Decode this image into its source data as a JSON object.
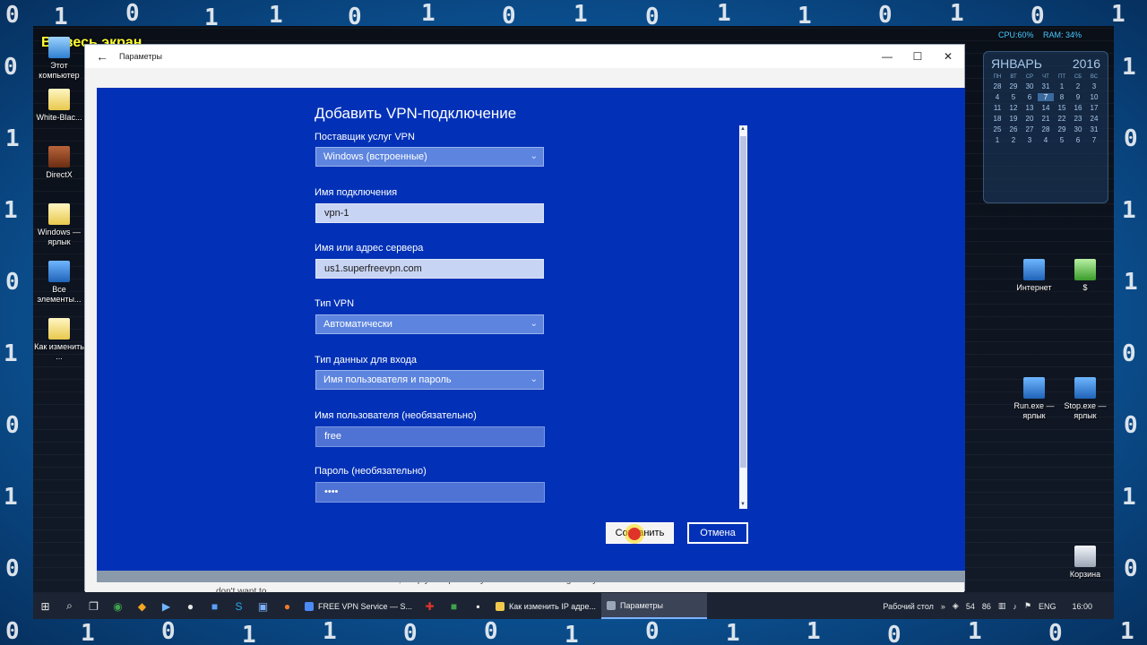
{
  "overlay": {
    "fullscreen_label": "Во весь экран"
  },
  "desktop": {
    "binary_digits": [
      "0",
      "1",
      "0",
      "1",
      "1",
      "0",
      "1",
      "0",
      "1",
      "0",
      "1",
      "1",
      "0",
      "1",
      "0",
      "1",
      "0",
      "1",
      "0",
      "1",
      "1",
      "0"
    ],
    "left_icons": [
      {
        "label": "Этот компьютер",
        "icon": "computer-icon"
      },
      {
        "label": "White-Blac...",
        "icon": "document-icon"
      },
      {
        "label": "DirectX",
        "icon": "archive-icon"
      },
      {
        "label": "Windows — ярлык",
        "icon": "shortcut-icon"
      },
      {
        "label": "Все элементы...",
        "icon": "control-panel-icon"
      },
      {
        "label": "Как изменить ...",
        "icon": "shortcut-icon"
      }
    ],
    "right_icons": [
      {
        "label": "Интернет",
        "icon": "network-icon"
      },
      {
        "label": "$",
        "icon": "notepad-icon"
      },
      {
        "label": "Run.exe — ярлык",
        "icon": "shortcut-icon"
      },
      {
        "label": "Stop.exe — ярлык",
        "icon": "shortcut-icon"
      },
      {
        "label": "Корзина",
        "icon": "recycle-bin-icon"
      }
    ]
  },
  "sysmon": {
    "cpu": "CPU:60%",
    "ram": "RAM: 34%"
  },
  "calendar": {
    "month": "ЯНВАРЬ",
    "year": "2016",
    "dows": [
      "ПН",
      "ВТ",
      "СР",
      "ЧТ",
      "ПТ",
      "СБ",
      "ВС"
    ],
    "days": [
      "28",
      "29",
      "30",
      "31",
      "1",
      "2",
      "3",
      "4",
      "5",
      "6",
      "7",
      "8",
      "9",
      "10",
      "11",
      "12",
      "13",
      "14",
      "15",
      "16",
      "17",
      "18",
      "19",
      "20",
      "21",
      "22",
      "23",
      "24",
      "25",
      "26",
      "27",
      "28",
      "29",
      "30",
      "31",
      "1",
      "2",
      "3",
      "4",
      "5",
      "6",
      "7"
    ],
    "today_index": 10
  },
  "window": {
    "title": "Параметры",
    "min_icon": "minimize-icon",
    "max_icon": "maximize-icon",
    "close_icon": "close-icon",
    "under_text": "mobile devices have PPTP VPN client build-in, simply setup it and you'll never notice it again if you don't want to."
  },
  "dialog": {
    "title": "Добавить VPN-подключение",
    "provider": {
      "label": "Поставщик услуг VPN",
      "value": "Windows (встроенные)"
    },
    "connection_name": {
      "label": "Имя подключения",
      "value": "vpn-1"
    },
    "server": {
      "label": "Имя или адрес сервера",
      "value": "us1.superfreevpn.com"
    },
    "vpn_type": {
      "label": "Тип VPN",
      "value": "Автоматически"
    },
    "signin_type": {
      "label": "Тип данных для входа",
      "value": "Имя пользователя и пароль"
    },
    "username": {
      "label": "Имя пользователя (необязательно)",
      "value": "free"
    },
    "password": {
      "label": "Пароль (необязательно)",
      "value": "••••"
    },
    "save_label": "Сохранить",
    "cancel_label": "Отмена"
  },
  "taskbar": {
    "apps": [
      {
        "label": "FREE VPN Service — S...",
        "color": "#4c8bf5"
      },
      {
        "label": "Как изменить IP адре...",
        "color": "#f2c94c"
      },
      {
        "label": "Параметры",
        "color": "#9aa7b8"
      }
    ],
    "desktop_label": "Рабочий стол",
    "tray_numbers": [
      "54",
      "86"
    ],
    "language": "ENG",
    "time": "16:00"
  }
}
